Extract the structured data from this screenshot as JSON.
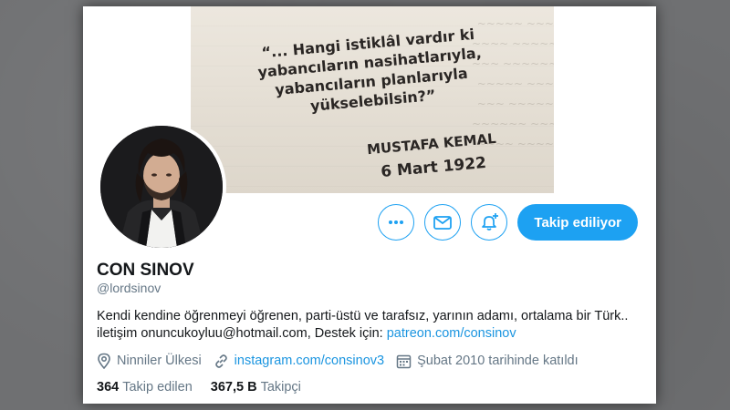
{
  "banner": {
    "quote_lines": [
      "“... Hangi istiklâl vardır ki",
      "yabancıların nasihatlarıyla,",
      "yabancıların planlarıyla",
      "yükselebilsin?”"
    ],
    "author": "MUSTAFA KEMAL",
    "date": "6 Mart 1922"
  },
  "actions": {
    "more_icon": "more-icon",
    "message_icon": "mail-icon",
    "notify_icon": "bell-plus-icon",
    "follow_label": "Takip ediliyor"
  },
  "profile": {
    "name": "CON SINOV",
    "handle": "@lordsinov",
    "bio_text": "Kendi kendine öğrenmeyi öğrenen, parti-üstü ve tarafsız, yarının adamı, ortalama bir Türk.. iletişim onuncukoyluu@hotmail.com, Destek için: ",
    "bio_link": "patreon.com/consinov",
    "location": "Ninniler Ülkesi",
    "website": "instagram.com/consinov3",
    "joined": "Şubat 2010 tarihinde katıldı",
    "following_count": "364",
    "following_label": "Takip edilen",
    "followers_count": "367,5 B",
    "followers_label": "Takipçi"
  },
  "colors": {
    "accent": "#1da1f2",
    "link": "#1b95e0",
    "secondary_text": "#657786",
    "primary_text": "#14171a"
  }
}
